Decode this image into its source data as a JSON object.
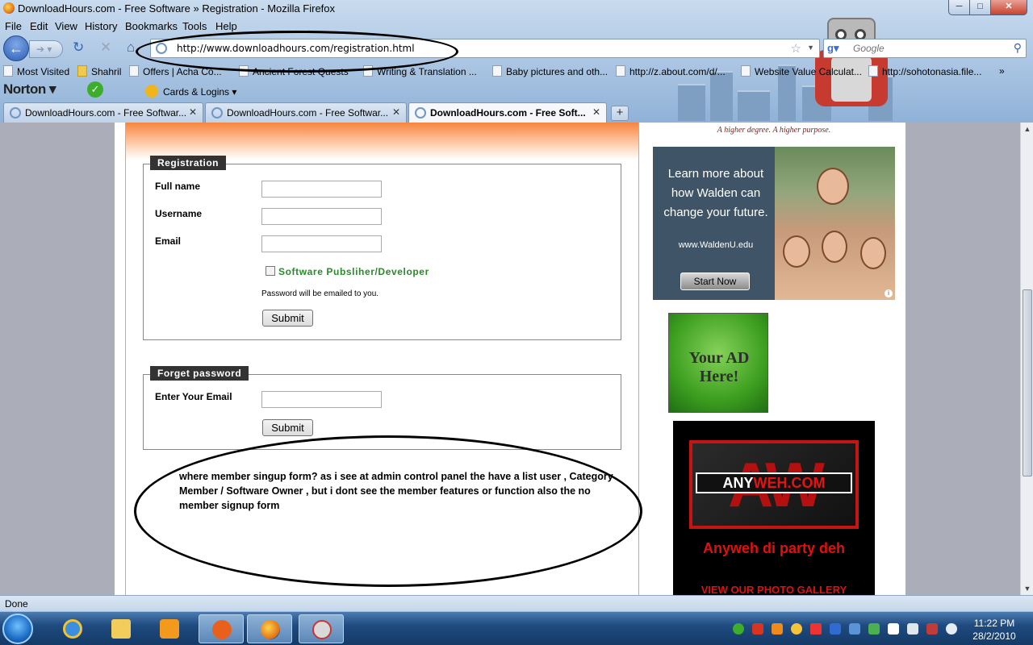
{
  "window": {
    "title": "DownloadHours.com - Free Software » Registration - Mozilla Firefox",
    "min": "─",
    "max": "□",
    "close": "✕"
  },
  "menu": [
    "File",
    "Edit",
    "View",
    "History",
    "Bookmarks",
    "Tools",
    "Help"
  ],
  "nav": {
    "url": "http://www.downloadhours.com/registration.html",
    "search_placeholder": "Google",
    "back_icon": "back-arrow-icon",
    "forward_icon": "forward-arrow-icon",
    "reload_icon": "reload-icon",
    "stop_icon": "stop-icon",
    "home_icon": "home-icon"
  },
  "bookmarks": [
    "Most Visited",
    "Shahril",
    "Offers | Acha Co...",
    "Ancient Forest Quests",
    "Writing & Translation ...",
    "Baby pictures and oth...",
    "http://z.about.com/d/...",
    "Website Value Calculat...",
    "http://sohotonasia.file..."
  ],
  "norton": {
    "logo": "Norton",
    "cards": "Cards & Logins"
  },
  "tabs": [
    {
      "label": "DownloadHours.com - Free Softwar...",
      "active": false
    },
    {
      "label": "DownloadHours.com - Free Softwar...",
      "active": false
    },
    {
      "label": "DownloadHours.com - Free Soft...",
      "active": true
    }
  ],
  "new_tab": "+",
  "registration": {
    "legend": "Registration",
    "fullname_label": "Full name",
    "username_label": "Username",
    "email_label": "Email",
    "publisher_label": "Software Pubsliher/Developer",
    "password_note": "Password will be emailed to you.",
    "submit": "Submit"
  },
  "forget": {
    "legend": "Forget password",
    "email_label": "Enter Your Email",
    "submit": "Submit"
  },
  "comment": "where member singup form? as i see at admin control panel the have a list user , Category Member / Software Owner , but i dont see the member features or function also the no member signup form",
  "ads": {
    "walden_tagline": "A higher degree. A higher purpose.",
    "walden_text": "Learn more about how Walden can change your future.",
    "walden_url": "www.WaldenU.edu",
    "walden_button": "Start Now",
    "your_ad": "Your AD Here!",
    "anyweh_part1": "ANY",
    "anyweh_part2": "WEH.COM",
    "anyweh_tagline": "Anyweh di party deh",
    "anyweh_gallery": "VIEW OUR PHOTO GALLERY"
  },
  "status": "Done",
  "clock": {
    "time": "11:22 PM",
    "date": "28/2/2010"
  },
  "colors": {
    "accent_orange": "#f7843e",
    "legend_bg": "#333333",
    "publisher_green": "#2a8a2a",
    "anyweh_red": "#e01010"
  }
}
